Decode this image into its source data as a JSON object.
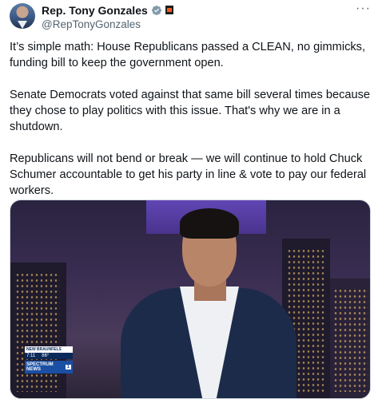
{
  "author": {
    "name": "Rep. Tony Gonzales",
    "handle": "@RepTonyGonzales"
  },
  "tweet": {
    "paragraphs": [
      "It’s simple math: House Republicans passed a CLEAN, no gimmicks, funding bill to keep the government open.",
      "Senate Democrats voted against that same bill several times because they chose to play politics with this issue. That's why we are in a shutdown.",
      "Republicans will not bend or break — we will continue to hold Chuck Schumer accountable to get his party in line & vote to pay our federal workers."
    ]
  },
  "media": {
    "chyron_location": "NEW BRAUNFELS",
    "chyron_time": "7:11",
    "chyron_temp": "86°",
    "network": "SPECTRUM NEWS",
    "channel": "1"
  },
  "icons": {
    "more": "more-icon",
    "verified": "verified-badge-icon",
    "flag": "flag-icon"
  },
  "colors": {
    "verified": "#829aab",
    "secondary_text": "#536471"
  }
}
